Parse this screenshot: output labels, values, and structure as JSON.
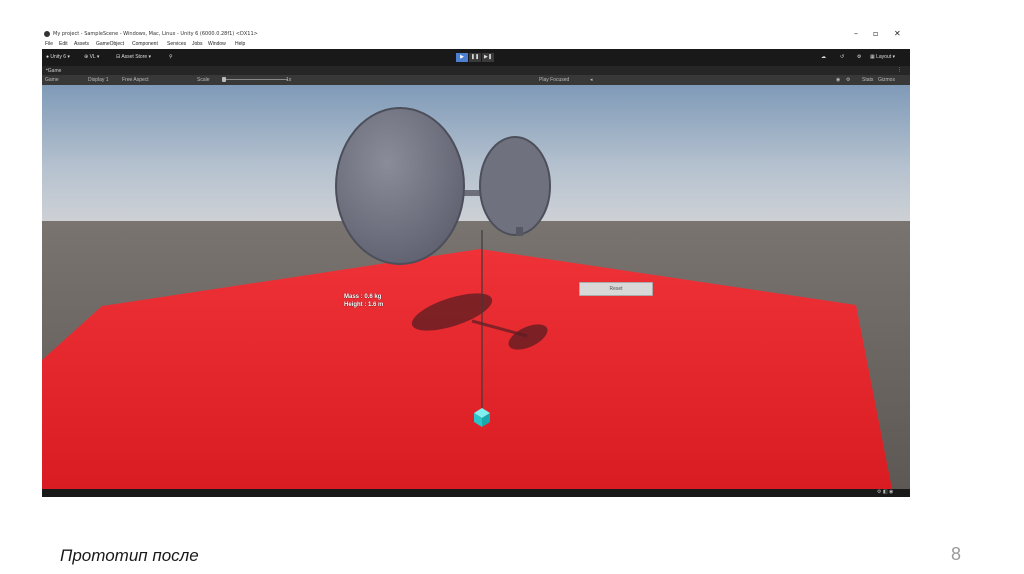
{
  "window": {
    "title": "My project - SampleScene - Windows, Mac, Linux - Unity 6 (6000.0.28f1) <DX11>",
    "controls": {
      "minimize": "–",
      "maximize": "▫",
      "close": "✕"
    }
  },
  "menu": [
    "File",
    "Edit",
    "Assets",
    "GameObject",
    "Component",
    "Services",
    "Jobs",
    "Window",
    "Help"
  ],
  "toolbar": {
    "account": "Unity 6",
    "vcs": "VL",
    "asset_store": "Asset Store",
    "layout": "Layout",
    "play_buttons": [
      "▶",
      "❚❚",
      "▶❚"
    ]
  },
  "game_tab": {
    "label": "Game"
  },
  "game_bar": {
    "mode": "Game",
    "display": "Display 1",
    "aspect": "Free Aspect",
    "scale_label": "Scale",
    "scale_value": "1x",
    "play_focused": "Play Focused",
    "stats": "Stats",
    "gizmos": "Gizmos"
  },
  "hud": {
    "mass": "Mass : 0.6 kg",
    "height": "Height : 1.6 m",
    "reset": "Reset"
  },
  "slide": {
    "caption": "Прототип после",
    "page_number": "8"
  },
  "colors": {
    "floor": "#e8232a",
    "toolbar": "#191919",
    "accent": "#4c7fd0",
    "cube": "#3ad8d8"
  }
}
